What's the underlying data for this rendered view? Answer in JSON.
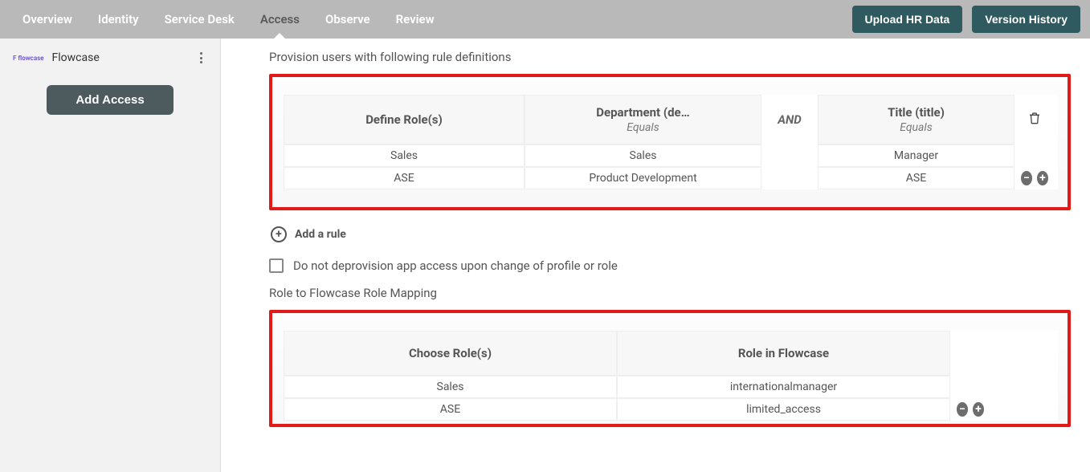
{
  "nav": {
    "items": [
      "Overview",
      "Identity",
      "Service Desk",
      "Access",
      "Observe",
      "Review"
    ],
    "active_index": 3,
    "btn_upload": "Upload HR Data",
    "btn_version": "Version History"
  },
  "sidebar": {
    "app_logo_text": "F flowcase",
    "app_name": "Flowcase",
    "add_access_label": "Add Access"
  },
  "rules_section": {
    "heading": "Provision users with following rule definitions",
    "col_define_roles": "Define Role(s)",
    "col_dept_header": "Department (de…",
    "col_dept_sub": "Equals",
    "col_and": "AND",
    "col_title_header": "Title (title)",
    "col_title_sub": "Equals",
    "rows": [
      {
        "role": "Sales",
        "dept": "Sales",
        "title": "Manager"
      },
      {
        "role": "ASE",
        "dept": "Product Development",
        "title": "ASE"
      }
    ],
    "add_rule_label": "Add a rule"
  },
  "deprov_checkbox": {
    "checked": false,
    "label": "Do not deprovision app access upon change of profile or role"
  },
  "role_map_section": {
    "heading": "Role to Flowcase Role Mapping",
    "col_choose_roles": "Choose Role(s)",
    "col_role_in_app": "Role in Flowcase",
    "rows": [
      {
        "local_role": "Sales",
        "app_role": "internationalmanager"
      },
      {
        "local_role": "ASE",
        "app_role": "limited_access"
      }
    ]
  }
}
